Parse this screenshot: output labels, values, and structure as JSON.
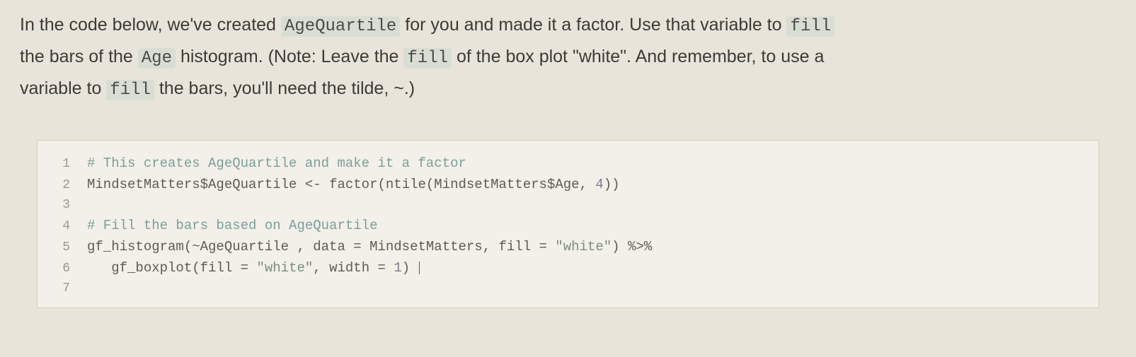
{
  "instructions": {
    "line1_pre": "In the code below, we've created ",
    "code1": "AgeQuartile",
    "line1_mid": " for you and made it a factor. Use that variable to ",
    "code2": "fill",
    "line2_pre": "the bars of the ",
    "code3": "Age",
    "line2_mid": " histogram. (Note: Leave the ",
    "code4": "fill",
    "line2_post": " of the box plot \"white\". And remember, to use a",
    "line3_pre": "variable to ",
    "code5": "fill",
    "line3_post": " the bars, you'll need the tilde, ~.)"
  },
  "code": {
    "lines": [
      {
        "n": "1",
        "segments": [
          {
            "cls": "c-comment",
            "t": "# This creates AgeQuartile and make it a factor"
          }
        ]
      },
      {
        "n": "2",
        "segments": [
          {
            "cls": "c-ident",
            "t": "MindsetMatters$AgeQuartile "
          },
          {
            "cls": "c-op",
            "t": "<-"
          },
          {
            "cls": "c-ident",
            "t": " factor(ntile(MindsetMatters$Age, "
          },
          {
            "cls": "c-num",
            "t": "4"
          },
          {
            "cls": "c-ident",
            "t": "))"
          }
        ]
      },
      {
        "n": "3",
        "segments": [
          {
            "cls": "c-ident",
            "t": ""
          }
        ]
      },
      {
        "n": "4",
        "segments": [
          {
            "cls": "c-comment",
            "t": "# Fill the bars based on AgeQuartile"
          }
        ]
      },
      {
        "n": "5",
        "segments": [
          {
            "cls": "c-func",
            "t": "gf_histogram"
          },
          {
            "cls": "c-ident",
            "t": "(~AgeQuartile , data = MindsetMatters, fill = "
          },
          {
            "cls": "c-string",
            "t": "\"white\""
          },
          {
            "cls": "c-ident",
            "t": ") "
          },
          {
            "cls": "c-op",
            "t": "%>%"
          }
        ]
      },
      {
        "n": "6",
        "segments": [
          {
            "cls": "c-ident",
            "t": "   "
          },
          {
            "cls": "c-func",
            "t": "gf_boxplot"
          },
          {
            "cls": "c-ident",
            "t": "(fill = "
          },
          {
            "cls": "c-string",
            "t": "\"white\""
          },
          {
            "cls": "c-ident",
            "t": ", width = "
          },
          {
            "cls": "c-num",
            "t": "1"
          },
          {
            "cls": "c-ident",
            "t": ") "
          }
        ]
      },
      {
        "n": "7",
        "segments": [
          {
            "cls": "c-ident",
            "t": ""
          }
        ]
      }
    ]
  }
}
